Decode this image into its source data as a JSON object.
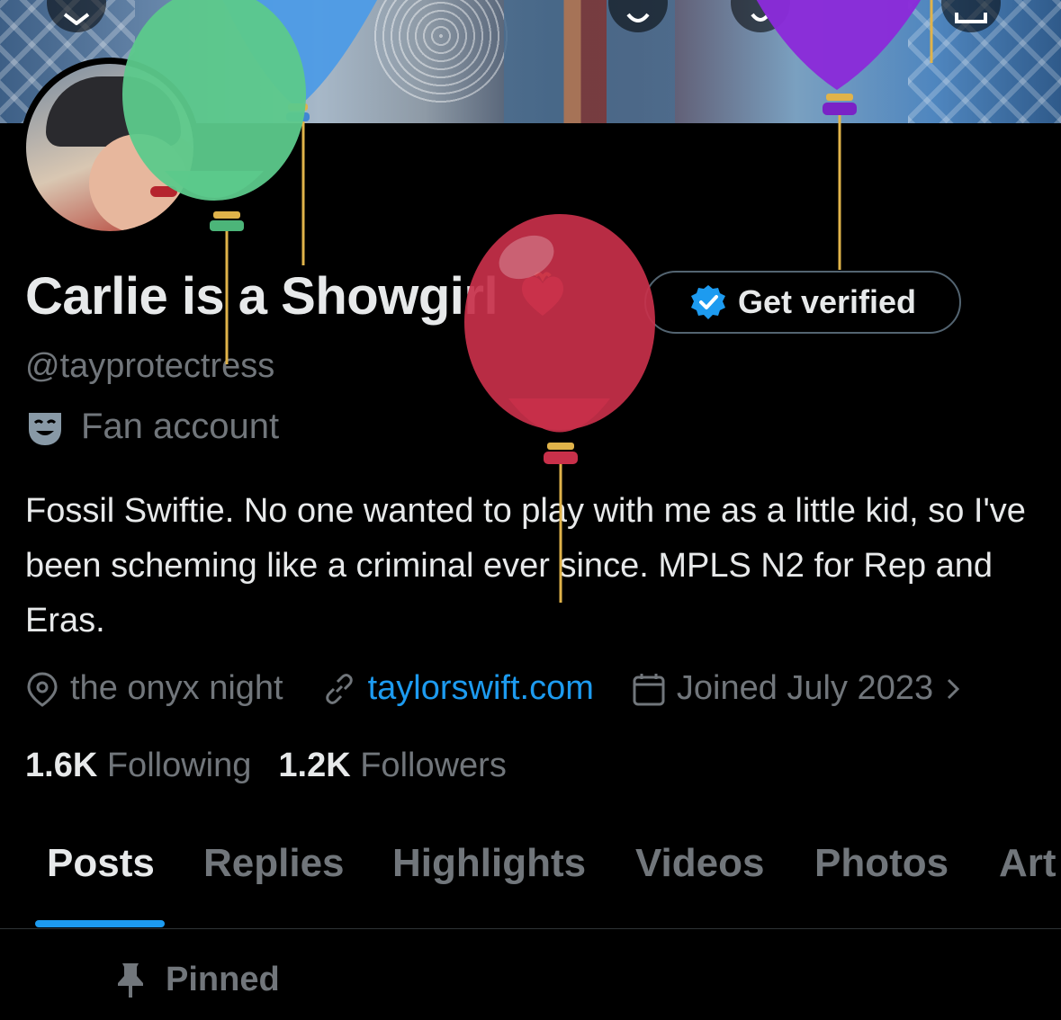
{
  "profile": {
    "display_name": "Carlie is a Showgirl",
    "name_emoji_icon": "burning-heart-icon",
    "handle": "@tayprotectress",
    "category": "Fan account",
    "category_icon": "performing-arts-masks-icon",
    "bio": "Fossil Swiftie. No one wanted to play with me as a little kid, so I've been scheming like a criminal ever since. MPLS N2 for Rep and Eras."
  },
  "actions": {
    "get_verified_label": "Get verified",
    "verified_badge_icon": "verified-badge-icon"
  },
  "meta": {
    "location": "the onyx night",
    "location_icon": "location-pin-icon",
    "website": "taylorswift.com",
    "website_icon": "link-icon",
    "joined": "Joined July 2023",
    "joined_icon": "calendar-icon",
    "more_icon": "chevron-right-icon"
  },
  "stats": {
    "following_count": "1.6K",
    "following_label": "Following",
    "followers_count": "1.2K",
    "followers_label": "Followers"
  },
  "tabs": [
    {
      "label": "Posts",
      "active": true
    },
    {
      "label": "Replies"
    },
    {
      "label": "Highlights"
    },
    {
      "label": "Videos"
    },
    {
      "label": "Photos"
    },
    {
      "label": "Art"
    }
  ],
  "pinned_label": "Pinned",
  "colors": {
    "accent": "#1d9bf0",
    "text_primary": "#e7e9ea",
    "text_secondary": "#71767b",
    "background": "#000000",
    "balloon_green": "#5cc98b",
    "balloon_blue": "#4d9be6",
    "balloon_purple": "#8a2bd9",
    "balloon_red": "#c8304a"
  }
}
